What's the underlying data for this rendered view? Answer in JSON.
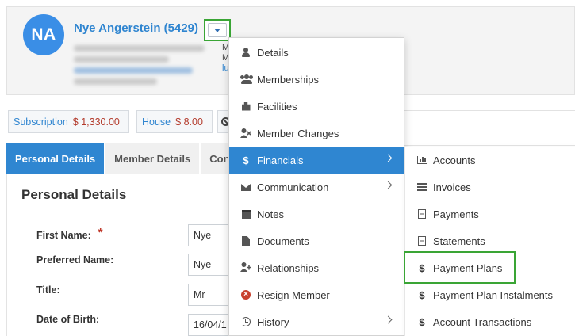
{
  "member": {
    "initials": "NA",
    "name": "Nye Angerstein (5429)"
  },
  "header_peeks": {
    "line1": "M",
    "line2": "M",
    "line3": "lu"
  },
  "balances": [
    {
      "label": "Subscription",
      "value": "$ 1,330.00"
    },
    {
      "label": "House",
      "value": "$ 8.00"
    }
  ],
  "tabs": [
    "Personal Details",
    "Member Details",
    "Con"
  ],
  "personal_details": {
    "title": "Personal Details",
    "fields": [
      {
        "label": "First Name:",
        "value": "Nye",
        "required": "*"
      },
      {
        "label": "Preferred Name:",
        "value": "Nye"
      },
      {
        "label": "Title:",
        "value": "Mr"
      },
      {
        "label": "Date of Birth:",
        "value": "16/04/1"
      }
    ]
  },
  "menu": {
    "items": [
      {
        "label": "Details",
        "icon": "user-icon"
      },
      {
        "label": "Memberships",
        "icon": "users-icon"
      },
      {
        "label": "Facilities",
        "icon": "puzzle-icon"
      },
      {
        "label": "Member Changes",
        "icon": "user-times-icon"
      },
      {
        "label": "Financials",
        "icon": "dollar-icon",
        "highlighted": true,
        "submenu": true
      },
      {
        "label": "Communication",
        "icon": "envelope-icon",
        "submenu": true
      },
      {
        "label": "Notes",
        "icon": "note-icon"
      },
      {
        "label": "Documents",
        "icon": "file-icon"
      },
      {
        "label": "Relationships",
        "icon": "user-plus-icon"
      },
      {
        "label": "Resign Member",
        "icon": "x-circle-icon"
      },
      {
        "label": "History",
        "icon": "history-icon",
        "submenu": true
      }
    ]
  },
  "submenu": {
    "items": [
      {
        "label": "Accounts",
        "icon": "bar-chart-icon"
      },
      {
        "label": "Invoices",
        "icon": "list-icon"
      },
      {
        "label": "Payments",
        "icon": "document-icon"
      },
      {
        "label": "Statements",
        "icon": "document-icon"
      },
      {
        "label": "Payment Plans",
        "icon": "dollar-icon",
        "outlined": true
      },
      {
        "label": "Payment Plan Instalments",
        "icon": "dollar-icon"
      },
      {
        "label": "Account Transactions",
        "icon": "dollar-icon"
      }
    ]
  },
  "colors": {
    "accent": "#2f86d1",
    "highlight_outline": "#3aa535",
    "amount_red": "#b33a2b",
    "danger": "#c8412e"
  }
}
